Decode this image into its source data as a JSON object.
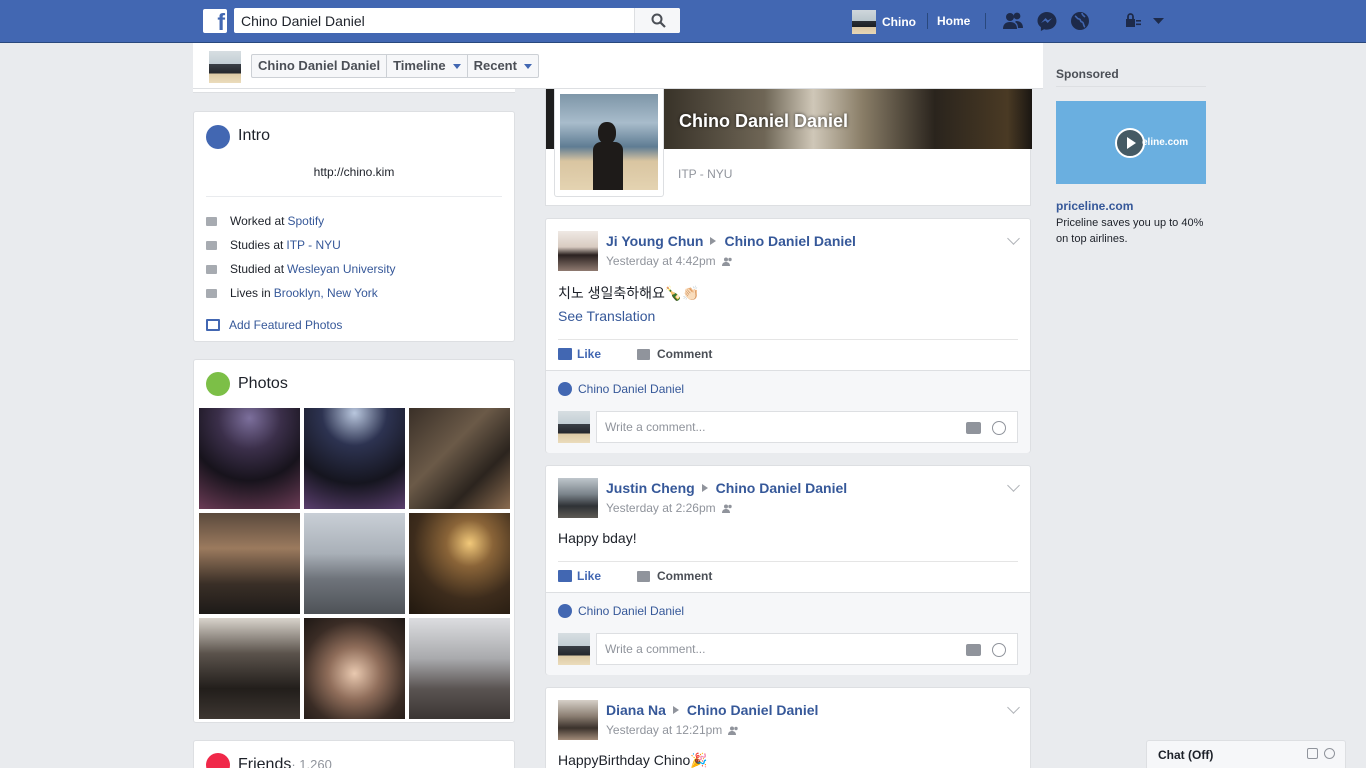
{
  "topbar": {
    "logo": "f",
    "search_value": "Chino Daniel Daniel",
    "user_name": "Chino",
    "home_label": "Home",
    "icons": [
      "friend-requests-icon",
      "messenger-icon",
      "notifications-globe-icon",
      "privacy-lock-icon",
      "account-menu-caret-icon"
    ]
  },
  "profile_strip": {
    "name_tab": "Chino Daniel Daniel",
    "timeline_tab": "Timeline",
    "recent_tab": "Recent"
  },
  "intro": {
    "title": "Intro",
    "url": "http://chino.kim",
    "rows": [
      {
        "prefix": "Worked at",
        "link": "Spotify"
      },
      {
        "prefix": "Studies at",
        "link": "ITP - NYU"
      },
      {
        "prefix": "Studied at",
        "link": "Wesleyan University"
      },
      {
        "prefix": "Lives in",
        "link": "Brooklyn, New York"
      }
    ],
    "featured_label": "Add Featured Photos"
  },
  "photos": {
    "title": "Photos"
  },
  "friends": {
    "title": "Friends",
    "count": "· 1,260"
  },
  "cover": {
    "name": "Chino Daniel Daniel",
    "subtitle": "ITP - NYU"
  },
  "posts": [
    {
      "author": "Ji Young Chun",
      "target": "Chino Daniel Daniel",
      "time": "Yesterday at 4:42pm",
      "text": "치노 생일축하해요🍾👏🏻",
      "see_translation": "See Translation",
      "like_label": "Like",
      "comment_label": "Comment",
      "liker": "Chino Daniel Daniel",
      "comment_placeholder": "Write a comment..."
    },
    {
      "author": "Justin Cheng",
      "target": "Chino Daniel Daniel",
      "time": "Yesterday at 2:26pm",
      "text": "Happy bday!",
      "like_label": "Like",
      "comment_label": "Comment",
      "liker": "Chino Daniel Daniel",
      "comment_placeholder": "Write a comment..."
    },
    {
      "author": "Diana Na",
      "target": "Chino Daniel Daniel",
      "time": "Yesterday at 12:21pm",
      "text": "HappyBirthday Chino🎉"
    }
  ],
  "sponsored": {
    "title": "Sponsored",
    "ad_image_text": "eline.com",
    "domain": "priceline.com",
    "description": "Priceline saves you up to 40% on top airlines."
  },
  "chat": {
    "label": "Chat (Off)"
  }
}
